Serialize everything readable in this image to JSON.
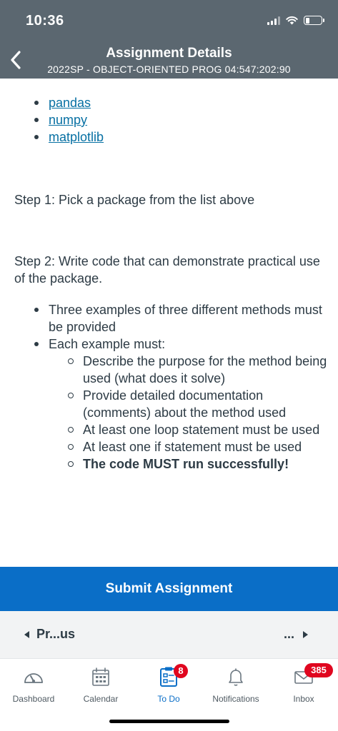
{
  "status": {
    "time": "10:36"
  },
  "header": {
    "title": "Assignment Details",
    "subtitle": "2022SP - OBJECT-ORIENTED PROG 04:547:202:90"
  },
  "content": {
    "packages": [
      "pandas",
      "numpy",
      "matplotlib"
    ],
    "step1": "Step 1: Pick a package from the list above",
    "step2": "Step 2: Write code that can demonstrate practical use of the package.",
    "bullets": {
      "b1": "Three examples of three different methods must be provided",
      "b2": "Each example must:",
      "sub": [
        "Describe the purpose for the method being used (what does it solve)",
        "Provide detailed documentation (comments) about the method used",
        "At least one loop statement must be used",
        "At least one if statement must be used",
        "The code MUST run successfully!"
      ]
    }
  },
  "submit_label": "Submit Assignment",
  "pager": {
    "prev_label": "Pr...us",
    "next_label": "..."
  },
  "tabs": [
    {
      "label": "Dashboard",
      "icon": "dashboard-icon"
    },
    {
      "label": "Calendar",
      "icon": "calendar-icon"
    },
    {
      "label": "To Do",
      "icon": "todo-icon",
      "badge": "8",
      "active": true
    },
    {
      "label": "Notifications",
      "icon": "bell-icon"
    },
    {
      "label": "Inbox",
      "icon": "inbox-icon",
      "badge": "385"
    }
  ],
  "colors": {
    "header_bg": "#5b6770",
    "accent": "#0a6ec7",
    "link": "#0770a3",
    "badge": "#e0061f",
    "text": "#2d3b45"
  }
}
